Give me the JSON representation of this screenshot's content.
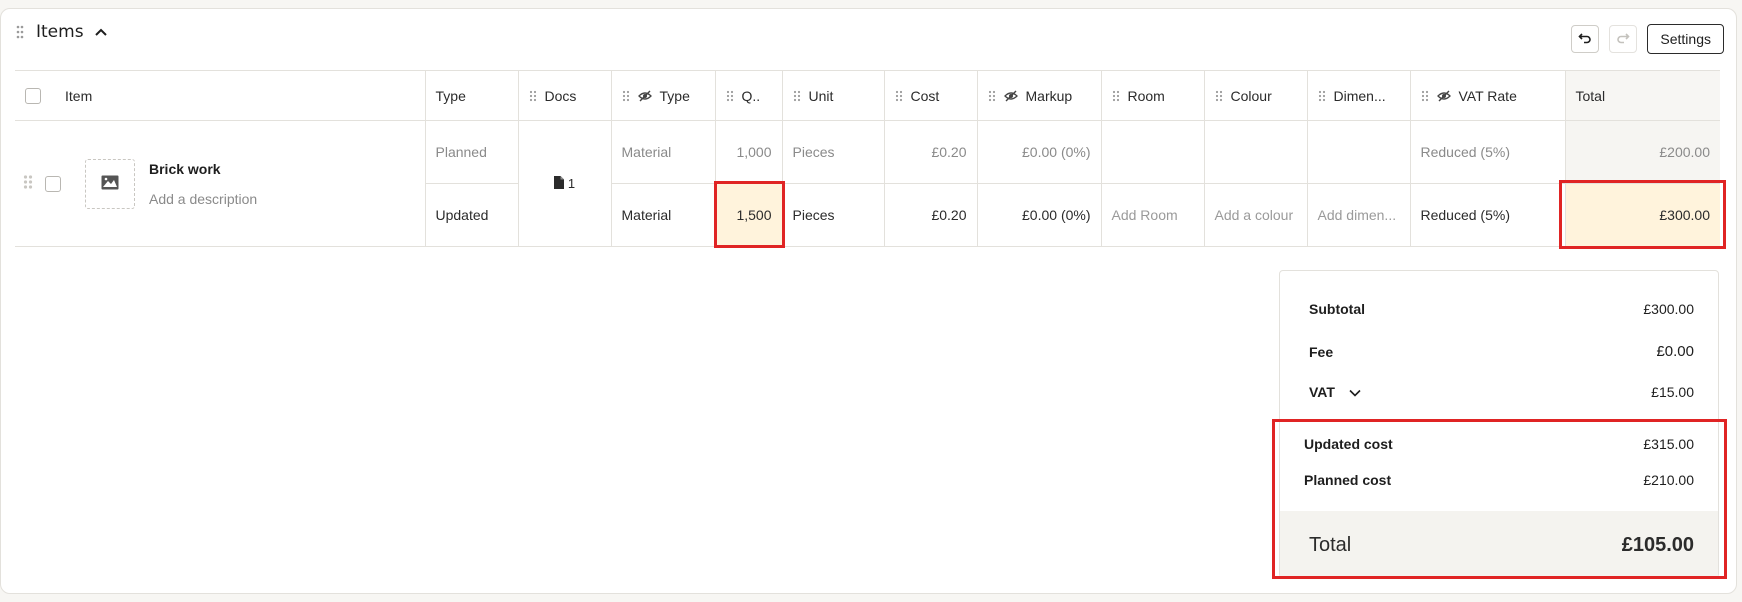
{
  "section": {
    "title": "Items"
  },
  "toolbar": {
    "settings_label": "Settings"
  },
  "columns": {
    "item": "Item",
    "type_stage": "Type",
    "docs": "Docs",
    "type": "Type",
    "qty": "Q..",
    "unit": "Unit",
    "cost": "Cost",
    "markup": "Markup",
    "room": "Room",
    "colour": "Colour",
    "dimensions": "Dimen...",
    "vat_rate": "VAT Rate",
    "total": "Total"
  },
  "item": {
    "name": "Brick work",
    "description_placeholder": "Add a description",
    "docs_count": "1",
    "planned": {
      "stage": "Planned",
      "type": "Material",
      "qty": "1,000",
      "unit": "Pieces",
      "cost": "£0.20",
      "markup": "£0.00 (0%)",
      "vat_rate": "Reduced (5%)",
      "total": "£200.00"
    },
    "updated": {
      "stage": "Updated",
      "type": "Material",
      "qty": "1,500",
      "unit": "Pieces",
      "cost": "£0.20",
      "markup": "£0.00 (0%)",
      "room_placeholder": "Add Room",
      "colour_placeholder": "Add a colour",
      "dimensions_placeholder": "Add dimen...",
      "vat_rate": "Reduced (5%)",
      "total": "£300.00"
    }
  },
  "summary": {
    "subtotal_label": "Subtotal",
    "subtotal_value": "£300.00",
    "fee_label": "Fee",
    "fee_value": "£0.00",
    "vat_label": "VAT",
    "vat_value": "£15.00",
    "updated_cost_label": "Updated cost",
    "updated_cost_value": "£315.00",
    "planned_cost_label": "Planned cost",
    "planned_cost_value": "£210.00",
    "total_label": "Total",
    "total_value": "£105.00"
  },
  "colors": {
    "highlight_bg": "#fff3dc",
    "annotation_red": "#e02424",
    "border": "#e3e1dc"
  },
  "icons": {
    "drag_handle": "drag-handle-icon",
    "collapse": "chevron-up-icon",
    "undo": "undo-icon",
    "redo": "redo-icon",
    "hidden": "eye-off-icon",
    "image": "image-icon",
    "document": "document-icon",
    "vat_expand": "chevron-down-icon"
  }
}
